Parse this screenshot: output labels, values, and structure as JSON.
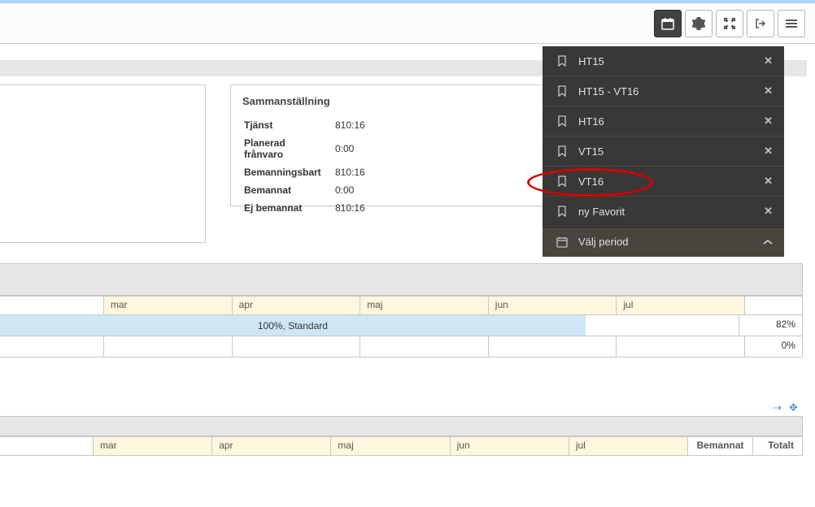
{
  "summary": {
    "title": "Sammanställning",
    "rows": [
      {
        "label": "Tjänst",
        "value": "810:16"
      },
      {
        "label": "Planerad frånvaro",
        "value": "0:00"
      },
      {
        "label": "Bemanningsbart",
        "value": "810:16"
      },
      {
        "label": "Bemannat",
        "value": "0:00"
      },
      {
        "label": "Ej bemannat",
        "value": "810:16"
      }
    ]
  },
  "dropdown": {
    "items": [
      {
        "label": "HT15"
      },
      {
        "label": "HT15 - VT16"
      },
      {
        "label": "HT16"
      },
      {
        "label": "VT15"
      },
      {
        "label": "VT16"
      },
      {
        "label": "ny Favorit"
      }
    ],
    "period_label": "Välj period"
  },
  "timeline1": {
    "months": [
      "mar",
      "apr",
      "maj",
      "jun",
      "jul"
    ],
    "bar_label": "100%, Standard",
    "bar_pct": "82%",
    "row2_pct": "0%"
  },
  "timeline2": {
    "months": [
      "mar",
      "apr",
      "maj",
      "jun",
      "jul"
    ],
    "col_bemannat": "Bemannat",
    "col_totalt": "Totalt"
  }
}
